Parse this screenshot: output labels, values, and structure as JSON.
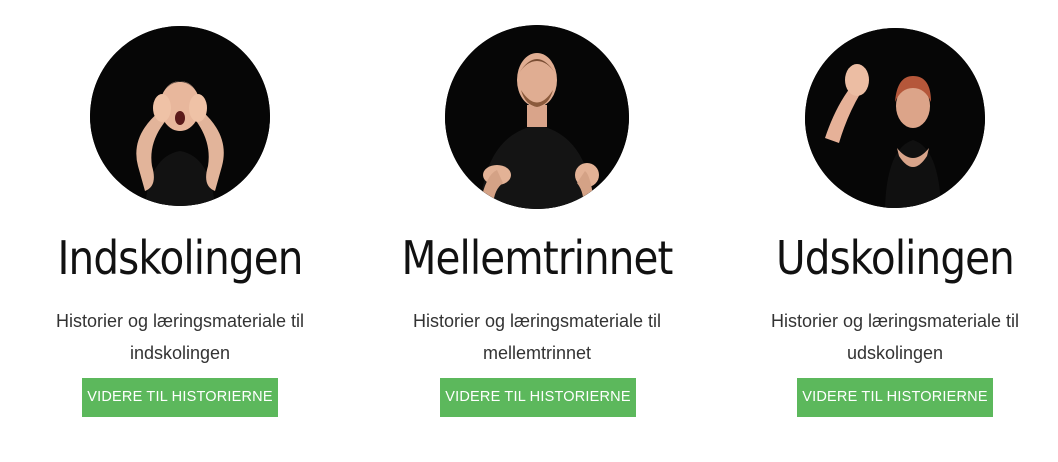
{
  "cards": [
    {
      "title": "Indskolingen",
      "description": "Historier og læringsmateriale til indskolingen",
      "button_label": "VIDERE TIL HISTORIERNE",
      "image_icon": "person-signing-photo"
    },
    {
      "title": "Mellemtrinnet",
      "description": "Historier og læringsmateriale til mellemtrinnet",
      "button_label": "VIDERE TIL HISTORIERNE",
      "image_icon": "person-signing-photo"
    },
    {
      "title": "Udskolingen",
      "description": "Historier og læringsmateriale til udskolingen",
      "button_label": "VIDERE TIL HISTORIERNE",
      "image_icon": "person-signing-photo"
    }
  ],
  "colors": {
    "button_bg": "#5cb85c",
    "button_text": "#ffffff",
    "avatar_bg": "#060606"
  }
}
